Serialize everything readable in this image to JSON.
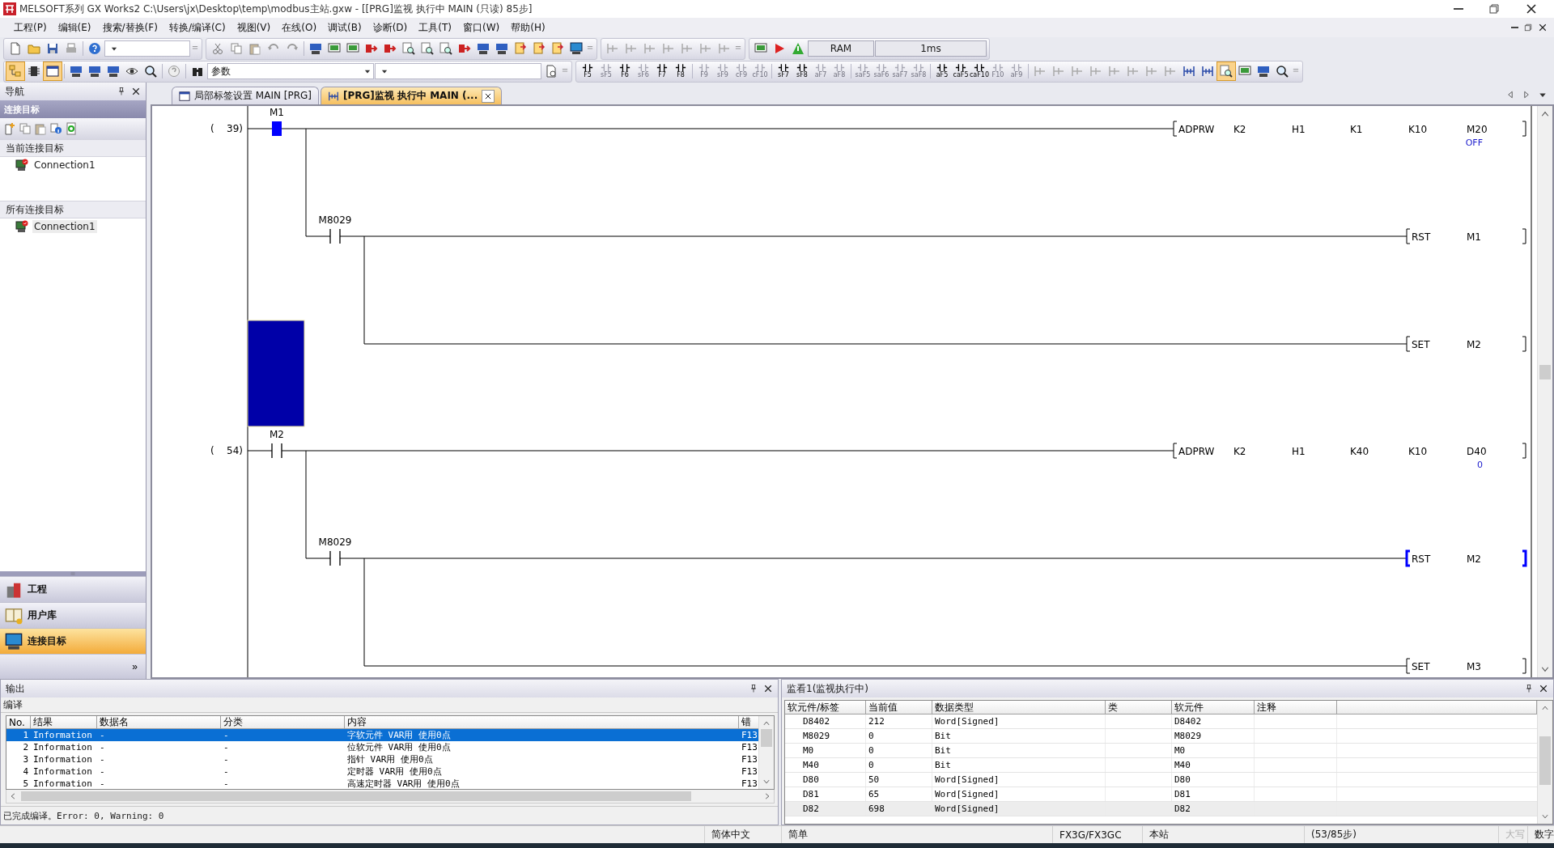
{
  "window": {
    "title": "MELSOFT系列 GX Works2 C:\\Users\\jx\\Desktop\\temp\\modbus主站.gxw - [[PRG]监视 执行中 MAIN (只读) 85步]"
  },
  "menu": [
    "工程(P)",
    "编辑(E)",
    "搜索/替换(F)",
    "转换/编译(C)",
    "视图(V)",
    "在线(O)",
    "调试(B)",
    "诊断(D)",
    "工具(T)",
    "窗口(W)",
    "帮助(H)"
  ],
  "toolbar": {
    "memory": "RAM",
    "scan_time": "1ms",
    "search_value": "参数",
    "key_buttons": [
      {
        "label": "F5",
        "disabled": false
      },
      {
        "label": "sF5",
        "disabled": true
      },
      {
        "label": "F6",
        "disabled": false
      },
      {
        "label": "sF6",
        "disabled": true
      },
      {
        "label": "F7",
        "disabled": false
      },
      {
        "label": "F8",
        "disabled": false
      },
      {
        "label": "F9",
        "disabled": true
      },
      {
        "label": "sF9",
        "disabled": true
      },
      {
        "label": "cF9",
        "disabled": true
      },
      {
        "label": "cF10",
        "disabled": true
      },
      {
        "label": "sF7",
        "disabled": false
      },
      {
        "label": "sF8",
        "disabled": false
      },
      {
        "label": "aF7",
        "disabled": true
      },
      {
        "label": "aF8",
        "disabled": true
      },
      {
        "label": "saF5",
        "disabled": true
      },
      {
        "label": "saF6",
        "disabled": true
      },
      {
        "label": "saF7",
        "disabled": true
      },
      {
        "label": "saF8",
        "disabled": true
      },
      {
        "label": "aF5",
        "disabled": false
      },
      {
        "label": "caF5",
        "disabled": false
      },
      {
        "label": "caF10",
        "disabled": false
      },
      {
        "label": "F10",
        "disabled": true
      },
      {
        "label": "aF9",
        "disabled": true
      }
    ]
  },
  "navigation": {
    "title": "导航",
    "section": "连接目标",
    "groups": [
      {
        "title": "当前连接目标",
        "items": [
          {
            "label": "Connection1",
            "selected": false
          }
        ]
      },
      {
        "title": "所有连接目标",
        "items": [
          {
            "label": "Connection1",
            "selected": true
          }
        ]
      }
    ],
    "bottom_items": [
      {
        "label": "工程",
        "selected": false
      },
      {
        "label": "用户库",
        "selected": false
      },
      {
        "label": "连接目标",
        "selected": true
      }
    ],
    "more": "»"
  },
  "tabs": [
    {
      "label": "局部标签设置 MAIN [PRG]",
      "selected": false
    },
    {
      "label": "[PRG]监视 执行中 MAIN (...",
      "selected": true
    }
  ],
  "ladder": {
    "cursor_visible": true,
    "rungs": [
      {
        "step": "(    39)",
        "lines": [
          {
            "contact": {
              "label": "M1",
              "on": true
            },
            "instruction": {
              "name": "ADPRW",
              "operands": [
                "K2",
                "H1",
                "K1",
                "K10",
                "M20"
              ],
              "monitor": "OFF",
              "on": false
            }
          },
          {
            "contact": {
              "label": "M8029",
              "on": false
            },
            "instruction": {
              "name": "RST",
              "operands": [
                "M1"
              ],
              "on": false
            }
          },
          {
            "instruction": {
              "name": "SET",
              "operands": [
                "M2"
              ],
              "on": false
            }
          }
        ]
      },
      {
        "step": "(    54)",
        "lines": [
          {
            "contact": {
              "label": "M2",
              "on": false
            },
            "instruction": {
              "name": "ADPRW",
              "operands": [
                "K2",
                "H1",
                "K40",
                "K10",
                "D40"
              ],
              "monitor": "0",
              "on": false
            }
          },
          {
            "contact": {
              "label": "M8029",
              "on": false
            },
            "instruction": {
              "name": "RST",
              "operands": [
                "M2"
              ],
              "on": true
            }
          },
          {
            "instruction": {
              "name": "SET",
              "operands": [
                "M3"
              ],
              "on": false
            }
          }
        ]
      }
    ]
  },
  "output": {
    "title": "输出",
    "category": "编译",
    "columns": [
      "No.",
      "结果",
      "数据名",
      "分类",
      "内容",
      "错"
    ],
    "rows": [
      {
        "cells": [
          "1",
          "Information",
          "-",
          "-",
          "字软元件 VAR用 使用0点",
          "F13"
        ],
        "selected": true
      },
      {
        "cells": [
          "2",
          "Information",
          "-",
          "-",
          "位软元件 VAR用 使用0点",
          "F13"
        ],
        "selected": false
      },
      {
        "cells": [
          "3",
          "Information",
          "-",
          "-",
          "指针 VAR用 使用0点",
          "F13"
        ],
        "selected": false
      },
      {
        "cells": [
          "4",
          "Information",
          "-",
          "-",
          "定时器 VAR用 使用0点",
          "F13"
        ],
        "selected": false
      },
      {
        "cells": [
          "5",
          "Information",
          "-",
          "-",
          "高速定时器 VAR用 使用0点",
          "F13"
        ],
        "selected": false
      }
    ],
    "summary": "已完成编译。Error: 0, Warning: 0"
  },
  "watch": {
    "title": "监看1(监视执行中)",
    "columns": [
      "软元件/标签",
      "当前值",
      "数据类型",
      "类",
      "软元件",
      "注释"
    ],
    "rows": [
      {
        "device": "D8402",
        "value": "212",
        "type": "Word[Signed]",
        "device_ref": "D8402",
        "selected": false
      },
      {
        "device": "M8029",
        "value": "0",
        "type": "Bit",
        "device_ref": "M8029",
        "selected": false
      },
      {
        "device": "M0",
        "value": "0",
        "type": "Bit",
        "device_ref": "M0",
        "selected": false
      },
      {
        "device": "M40",
        "value": "0",
        "type": "Bit",
        "device_ref": "M40",
        "selected": false
      },
      {
        "device": "D80",
        "value": "50",
        "type": "Word[Signed]",
        "device_ref": "D80",
        "selected": false
      },
      {
        "device": "D81",
        "value": "65",
        "type": "Word[Signed]",
        "device_ref": "D81",
        "selected": false
      },
      {
        "device": "D82",
        "value": "698",
        "type": "Word[Signed]",
        "device_ref": "D82",
        "selected": true
      }
    ]
  },
  "status_bar": [
    {
      "text": "简体中文",
      "disabled": false
    },
    {
      "text": "简单",
      "disabled": false
    },
    {
      "text": "FX3G/FX3GC",
      "disabled": false
    },
    {
      "text": "本站",
      "disabled": false
    },
    {
      "text": "(53/85步)",
      "disabled": false
    },
    {
      "text": "大写",
      "disabled": true
    },
    {
      "text": "数字",
      "disabled": false
    }
  ]
}
